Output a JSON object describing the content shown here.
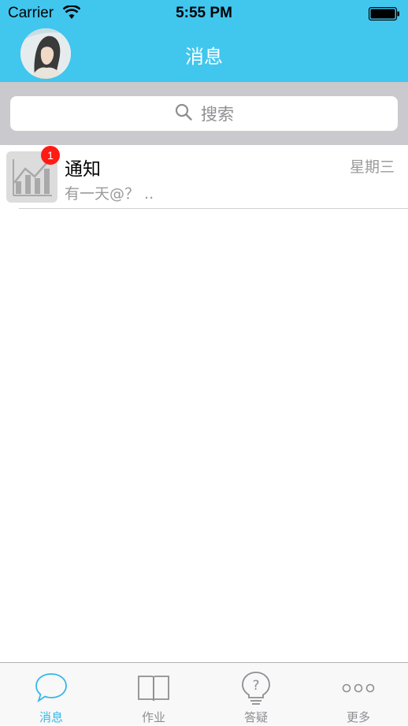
{
  "status_bar": {
    "carrier": "Carrier",
    "time": "5:55 PM"
  },
  "nav": {
    "title": "消息"
  },
  "search": {
    "placeholder": "搜索"
  },
  "messages": [
    {
      "title": "通知",
      "subtitle": "有一天@？ ..",
      "date": "星期三",
      "badge": "1"
    }
  ],
  "tabs": [
    {
      "label": "消息",
      "icon": "chat-bubble-icon",
      "active": true
    },
    {
      "label": "作业",
      "icon": "book-icon",
      "active": false
    },
    {
      "label": "答疑",
      "icon": "question-bulb-icon",
      "active": false
    },
    {
      "label": "更多",
      "icon": "more-dots-icon",
      "active": false
    }
  ],
  "colors": {
    "accent": "#41c6ee",
    "badge": "#ff1b14",
    "active_tab": "#35b8e8"
  }
}
